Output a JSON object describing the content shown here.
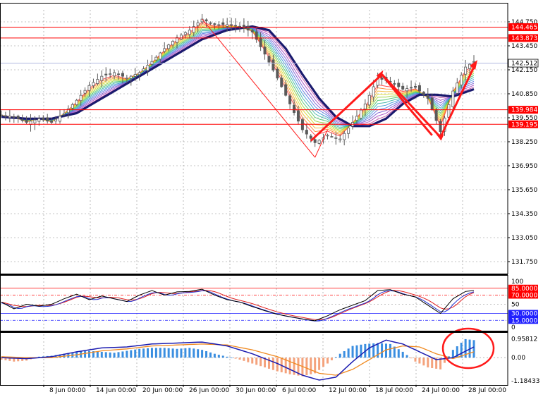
{
  "colors": {
    "background": "#ffffff",
    "grid": "#8a8a8a",
    "frame": "#000000",
    "candle": "#5a5a5a",
    "slow_ma": "#1a1a6e",
    "hline": "#ff0000",
    "current_line": "#b0b8e0",
    "current_label_bg": "#ffffff",
    "label_red": "#ff0000",
    "rsi_black": "#000000",
    "rsi_blue": "#2030d0",
    "rsi_red": "#e02020",
    "macd_up": "#3a8ee0",
    "macd_down": "#f4a27c",
    "macd_line": "#1c1cb0",
    "signal_line": "#f08a20",
    "osc_level_blue": "#2020ff",
    "annotation": "#ff1a1a"
  },
  "chart_data": {
    "type": "candlestick",
    "price_axis": {
      "ylim": [
        131.1,
        145.4
      ],
      "ticks": [
        "144.750",
        "143.450",
        "142.150",
        "140.850",
        "139.550",
        "138.250",
        "136.950",
        "135.650",
        "134.350",
        "133.050",
        "131.750"
      ]
    },
    "x_axis": {
      "ticks": [
        "8 Jun 00:00",
        "14 Jun 00:00",
        "20 Jun 00:00",
        "26 Jun 00:00",
        "30 Jun 00:00",
        "6 Jul 00:00",
        "12 Jul 00:00",
        "18 Jul 00:00",
        "24 Jul 00:00",
        "28 Jul 00:00"
      ]
    },
    "horizontal_levels": [
      {
        "label": "144.465",
        "value": 144.465
      },
      {
        "label": "143.873",
        "value": 143.873
      },
      {
        "label": "139.984",
        "value": 139.984
      },
      {
        "label": "139.195",
        "value": 139.195
      }
    ],
    "current_price": {
      "label": "142.512",
      "value": 142.512
    },
    "price_path": [
      [
        0,
        139.7
      ],
      [
        3,
        139.6
      ],
      [
        6,
        139.3
      ],
      [
        9,
        139.5
      ],
      [
        12,
        139.3
      ],
      [
        15,
        139.8
      ],
      [
        18,
        140.5
      ],
      [
        21,
        141.3
      ],
      [
        24,
        141.8
      ],
      [
        27,
        142.0
      ],
      [
        30,
        141.7
      ],
      [
        33,
        142.0
      ],
      [
        36,
        142.6
      ],
      [
        39,
        143.3
      ],
      [
        42,
        143.9
      ],
      [
        45,
        144.3
      ],
      [
        48,
        144.9
      ],
      [
        51,
        144.6
      ],
      [
        54,
        144.6
      ],
      [
        57,
        144.5
      ],
      [
        60,
        144.2
      ],
      [
        63,
        143.0
      ],
      [
        66,
        141.7
      ],
      [
        69,
        140.3
      ],
      [
        72,
        138.9
      ],
      [
        75,
        138.2
      ],
      [
        78,
        138.6
      ],
      [
        81,
        138.4
      ],
      [
        84,
        139.3
      ],
      [
        87,
        140.3
      ],
      [
        90,
        141.7
      ],
      [
        93,
        141.5
      ],
      [
        96,
        141.1
      ],
      [
        99,
        141.2
      ],
      [
        102,
        140.6
      ],
      [
        105,
        138.8
      ],
      [
        108,
        141.0
      ],
      [
        111,
        142.3
      ],
      [
        113,
        142.6
      ]
    ],
    "slow_ma": [
      [
        0,
        139.6
      ],
      [
        6,
        139.5
      ],
      [
        12,
        139.5
      ],
      [
        18,
        139.8
      ],
      [
        24,
        140.6
      ],
      [
        30,
        141.4
      ],
      [
        36,
        142.2
      ],
      [
        42,
        143.0
      ],
      [
        48,
        143.8
      ],
      [
        54,
        144.3
      ],
      [
        60,
        144.5
      ],
      [
        64,
        144.3
      ],
      [
        68,
        143.3
      ],
      [
        72,
        141.9
      ],
      [
        76,
        140.6
      ],
      [
        80,
        139.6
      ],
      [
        84,
        139.1
      ],
      [
        88,
        139.1
      ],
      [
        92,
        139.5
      ],
      [
        96,
        140.3
      ],
      [
        100,
        140.8
      ],
      [
        104,
        140.8
      ],
      [
        108,
        140.7
      ],
      [
        113,
        141.1
      ]
    ],
    "rsi": {
      "ylim": [
        0,
        100
      ],
      "ticks": [
        "100",
        "50",
        "0"
      ],
      "levels": [
        {
          "label": "85.0000",
          "value": 85
        },
        {
          "label": "70.0000",
          "value": 70
        },
        {
          "label": "30.0000",
          "value": 30
        },
        {
          "label": "15.0000",
          "value": 15
        }
      ],
      "series_black": [
        [
          0,
          55
        ],
        [
          3,
          40
        ],
        [
          6,
          50
        ],
        [
          9,
          46
        ],
        [
          12,
          50
        ],
        [
          15,
          62
        ],
        [
          18,
          72
        ],
        [
          21,
          60
        ],
        [
          24,
          68
        ],
        [
          27,
          62
        ],
        [
          30,
          56
        ],
        [
          33,
          70
        ],
        [
          36,
          80
        ],
        [
          39,
          70
        ],
        [
          42,
          77
        ],
        [
          45,
          78
        ],
        [
          48,
          83
        ],
        [
          51,
          70
        ],
        [
          54,
          60
        ],
        [
          57,
          55
        ],
        [
          60,
          45
        ],
        [
          63,
          36
        ],
        [
          66,
          28
        ],
        [
          69,
          23
        ],
        [
          72,
          18
        ],
        [
          75,
          14
        ],
        [
          78,
          25
        ],
        [
          81,
          38
        ],
        [
          84,
          48
        ],
        [
          87,
          58
        ],
        [
          90,
          80
        ],
        [
          93,
          82
        ],
        [
          96,
          72
        ],
        [
          99,
          66
        ],
        [
          102,
          48
        ],
        [
          105,
          30
        ],
        [
          108,
          62
        ],
        [
          111,
          78
        ],
        [
          113,
          80
        ]
      ]
    },
    "macd": {
      "ticks": [
        "0.95812",
        "0.00",
        "-1.18433"
      ],
      "ylim": [
        -1.18433,
        1.2
      ],
      "histogram": [
        [
          0,
          -0.1
        ],
        [
          3,
          -0.2
        ],
        [
          6,
          -0.15
        ],
        [
          9,
          0.05
        ],
        [
          12,
          0.1
        ],
        [
          15,
          0.2
        ],
        [
          18,
          0.3
        ],
        [
          21,
          0.35
        ],
        [
          24,
          0.3
        ],
        [
          27,
          0.25
        ],
        [
          30,
          0.35
        ],
        [
          33,
          0.45
        ],
        [
          36,
          0.5
        ],
        [
          39,
          0.5
        ],
        [
          42,
          0.45
        ],
        [
          45,
          0.5
        ],
        [
          48,
          0.4
        ],
        [
          51,
          0.2
        ],
        [
          54,
          0.05
        ],
        [
          57,
          -0.1
        ],
        [
          60,
          -0.3
        ],
        [
          63,
          -0.5
        ],
        [
          66,
          -0.7
        ],
        [
          69,
          -0.85
        ],
        [
          72,
          -0.95
        ],
        [
          75,
          -0.8
        ],
        [
          78,
          -0.3
        ],
        [
          81,
          0.2
        ],
        [
          84,
          0.6
        ],
        [
          87,
          0.7
        ],
        [
          90,
          0.75
        ],
        [
          93,
          0.7
        ],
        [
          96,
          0.3
        ],
        [
          99,
          -0.2
        ],
        [
          102,
          -0.5
        ],
        [
          105,
          -0.6
        ],
        [
          108,
          0.4
        ],
        [
          111,
          0.95
        ],
        [
          113,
          0.9
        ]
      ],
      "macd_line": [
        [
          0,
          0.0
        ],
        [
          6,
          -0.05
        ],
        [
          12,
          0.05
        ],
        [
          18,
          0.3
        ],
        [
          24,
          0.5
        ],
        [
          30,
          0.55
        ],
        [
          36,
          0.7
        ],
        [
          42,
          0.75
        ],
        [
          48,
          0.8
        ],
        [
          54,
          0.6
        ],
        [
          60,
          0.2
        ],
        [
          66,
          -0.3
        ],
        [
          72,
          -0.9
        ],
        [
          76,
          -1.15
        ],
        [
          80,
          -1.0
        ],
        [
          84,
          -0.2
        ],
        [
          88,
          0.5
        ],
        [
          92,
          0.9
        ],
        [
          96,
          0.7
        ],
        [
          100,
          0.3
        ],
        [
          104,
          -0.1
        ],
        [
          108,
          0.0
        ],
        [
          113,
          0.55
        ]
      ],
      "signal_line": [
        [
          0,
          0.05
        ],
        [
          6,
          0.0
        ],
        [
          12,
          0.0
        ],
        [
          18,
          0.15
        ],
        [
          24,
          0.35
        ],
        [
          30,
          0.45
        ],
        [
          36,
          0.6
        ],
        [
          42,
          0.65
        ],
        [
          48,
          0.7
        ],
        [
          54,
          0.65
        ],
        [
          60,
          0.4
        ],
        [
          66,
          0.05
        ],
        [
          72,
          -0.45
        ],
        [
          76,
          -0.8
        ],
        [
          80,
          -0.9
        ],
        [
          84,
          -0.6
        ],
        [
          88,
          -0.1
        ],
        [
          92,
          0.4
        ],
        [
          96,
          0.6
        ],
        [
          100,
          0.55
        ],
        [
          104,
          0.2
        ],
        [
          108,
          -0.05
        ],
        [
          113,
          0.3
        ]
      ]
    }
  }
}
